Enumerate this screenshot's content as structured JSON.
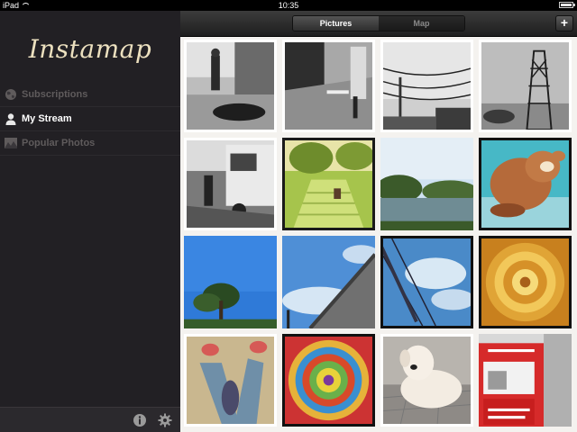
{
  "status": {
    "device": "iPad",
    "time": "10:35"
  },
  "sidebar": {
    "app_title": "Instamap",
    "items": [
      {
        "label": "Subscriptions",
        "icon": "globe-icon",
        "active": false
      },
      {
        "label": "My Stream",
        "icon": "person-icon",
        "active": true
      },
      {
        "label": "Popular Photos",
        "icon": "landscape-icon",
        "active": false
      }
    ],
    "footer": {
      "info_icon": "info-icon",
      "settings_icon": "gear-icon"
    }
  },
  "toolbar": {
    "segments": [
      "Pictures",
      "Map"
    ],
    "selected": "Pictures",
    "add_label": "+"
  },
  "photos": [
    {
      "label": "bw street shadow",
      "icon": "photo-thumbnail"
    },
    {
      "label": "bw walking sidewalk",
      "icon": "photo-thumbnail"
    },
    {
      "label": "bw power lines",
      "icon": "photo-thumbnail"
    },
    {
      "label": "bw pylon",
      "icon": "photo-thumbnail"
    },
    {
      "label": "bw street truck",
      "icon": "photo-thumbnail"
    },
    {
      "label": "green stairs",
      "icon": "photo-thumbnail"
    },
    {
      "label": "pond sky",
      "icon": "photo-thumbnail"
    },
    {
      "label": "plush toy",
      "icon": "photo-thumbnail"
    },
    {
      "label": "blue sky tree",
      "icon": "photo-thumbnail"
    },
    {
      "label": "blue sky highway",
      "icon": "photo-thumbnail"
    },
    {
      "label": "sky clouds",
      "icon": "photo-thumbnail"
    },
    {
      "label": "golden circle",
      "icon": "photo-thumbnail"
    },
    {
      "label": "feet sneakers",
      "icon": "photo-thumbnail"
    },
    {
      "label": "colorful spiral",
      "icon": "photo-thumbnail"
    },
    {
      "label": "dog lying",
      "icon": "photo-thumbnail"
    },
    {
      "label": "red stall",
      "icon": "photo-thumbnail"
    }
  ]
}
